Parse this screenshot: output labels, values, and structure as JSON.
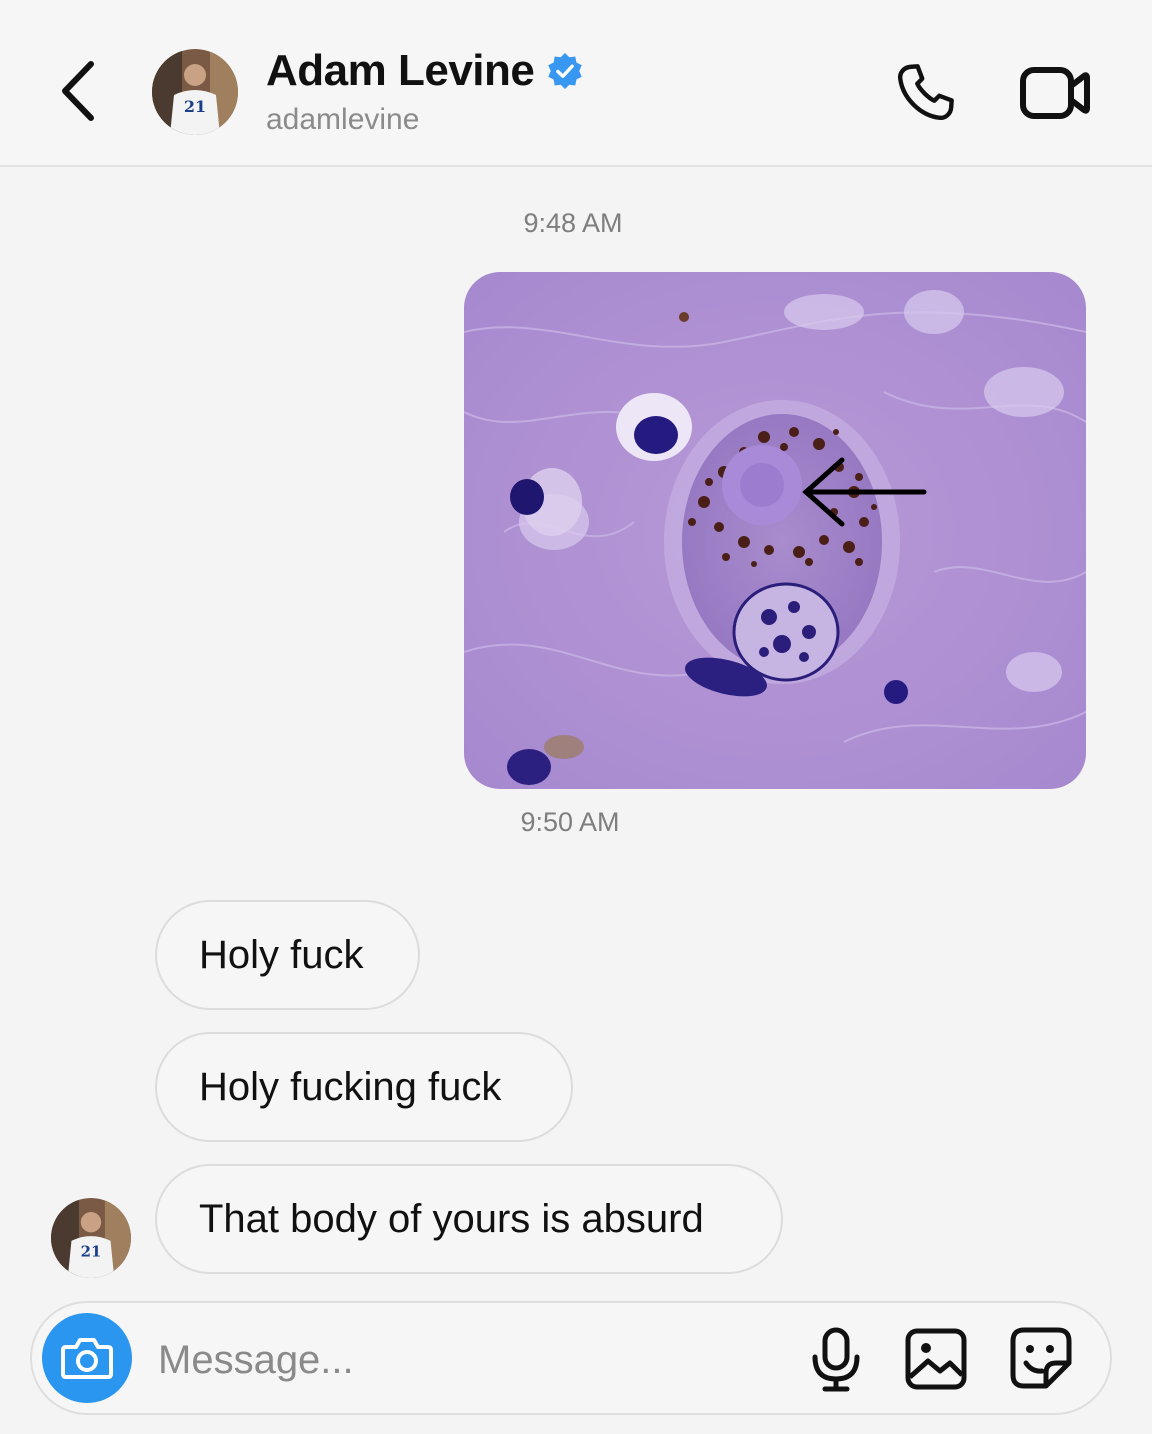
{
  "header": {
    "contact_name": "Adam Levine",
    "username": "adamlevine",
    "verified": true,
    "icons": {
      "back": "chevron-left-icon",
      "call": "phone-icon",
      "video": "video-camera-icon",
      "verified": "verified-badge-icon"
    }
  },
  "thread": {
    "timestamps": [
      "9:48 AM",
      "9:50 AM"
    ],
    "messages": [
      {
        "type": "image",
        "from": "me",
        "content": "histology micrograph with arrow"
      },
      {
        "type": "text",
        "from": "them",
        "text": "Holy fuck"
      },
      {
        "type": "text",
        "from": "them",
        "text": "Holy fucking fuck"
      },
      {
        "type": "text",
        "from": "them",
        "text": "That body of yours is absurd"
      }
    ]
  },
  "composer": {
    "placeholder": "Message...",
    "value": "",
    "icons": {
      "camera": "camera-icon",
      "mic": "microphone-icon",
      "gallery": "image-icon",
      "sticker": "sticker-icon"
    }
  },
  "colors": {
    "accent": "#2a96ef",
    "background": "#f4f4f4",
    "bubble_border": "#dcdcdc",
    "verified_badge": "#3897f0"
  }
}
